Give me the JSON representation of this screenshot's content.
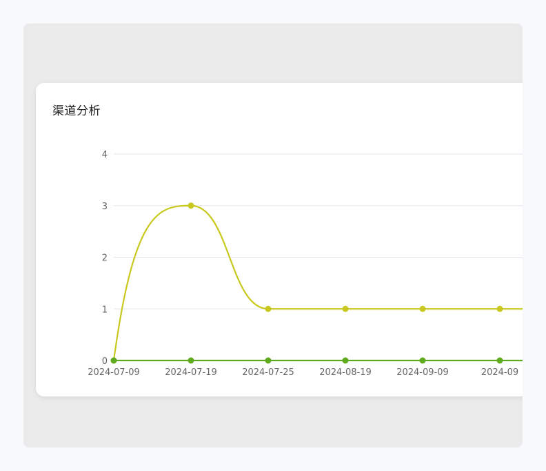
{
  "card": {
    "title": "渠道分析"
  },
  "chart_data": {
    "type": "line",
    "title": "渠道分析",
    "xlabel": "",
    "ylabel": "",
    "x": [
      "2024-07-09",
      "2024-07-19",
      "2024-07-25",
      "2024-08-19",
      "2024-09-09",
      "2024-09"
    ],
    "yticks": [
      0,
      1,
      2,
      3,
      4
    ],
    "ylim": [
      0,
      4
    ],
    "grid": true,
    "series": [
      {
        "values": [
          0,
          3,
          1,
          1,
          1,
          1
        ],
        "color": "#c8c81e",
        "smooth": true
      },
      {
        "values": [
          0,
          0,
          0,
          0,
          0,
          0
        ],
        "color": "#5ea91e",
        "smooth": false
      }
    ],
    "axis_color": "#5ea91e",
    "grid_color": "#e3e6ee"
  }
}
